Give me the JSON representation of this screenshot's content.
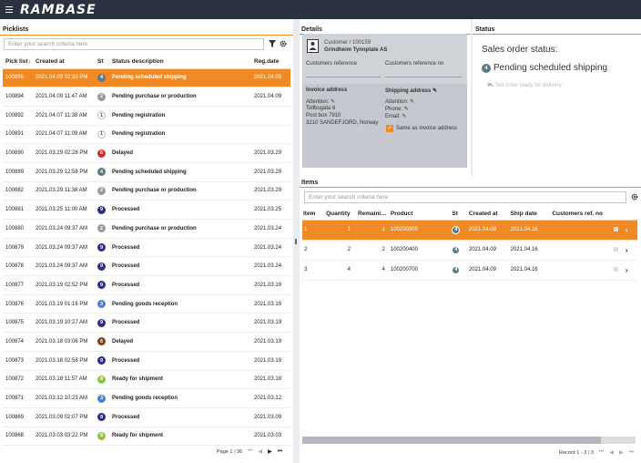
{
  "app": {
    "logo": "RAMBASE"
  },
  "picklists": {
    "title": "Picklists",
    "search_placeholder": "Enter your search criteria here",
    "columns": {
      "id": "Pick list",
      "sort": "↓",
      "created": "Created at",
      "st": "St",
      "desc": "Status description",
      "reg": "Reg.date"
    },
    "rows": [
      {
        "id": "100895",
        "created": "2021.04.09 02:20 PM",
        "st": "4",
        "st_color": "#5e7886",
        "desc": "Pending scheduled shipping",
        "reg": "2021.04.09",
        "selected": true
      },
      {
        "id": "100894",
        "created": "2021.04.09 11:47 AM",
        "st": "2",
        "st_color": "#9a9a9a",
        "desc": "Pending purchase or production",
        "reg": "2021.04.09"
      },
      {
        "id": "100892",
        "created": "2021.04.07 11:38 AM",
        "st": "1",
        "st_color": "outline",
        "desc": "Pending registration",
        "reg": ""
      },
      {
        "id": "100891",
        "created": "2021.04.07 11:09 AM",
        "st": "1",
        "st_color": "outline",
        "desc": "Pending registration",
        "reg": ""
      },
      {
        "id": "100890",
        "created": "2021.03.29 02:28 PM",
        "st": "6",
        "st_color": "#d92b2b",
        "desc": "Delayed",
        "reg": "2021.03.29"
      },
      {
        "id": "100889",
        "created": "2021.03.29 12:58 PM",
        "st": "4",
        "st_color": "#5e7886",
        "desc": "Pending scheduled shipping",
        "reg": "2021.03.29"
      },
      {
        "id": "100882",
        "created": "2021.03.29 11:38 AM",
        "st": "2",
        "st_color": "#9a9a9a",
        "desc": "Pending purchase or production",
        "reg": "2021.03.29"
      },
      {
        "id": "100881",
        "created": "2021.03.25 11:00 AM",
        "st": "9",
        "st_color": "#2a2f8f",
        "desc": "Processed",
        "reg": "2021.03.25"
      },
      {
        "id": "100880",
        "created": "2021.03.24 09:37 AM",
        "st": "2",
        "st_color": "#9a9a9a",
        "desc": "Pending purchase or production",
        "reg": "2021.03.24"
      },
      {
        "id": "100879",
        "created": "2021.03.24 09:37 AM",
        "st": "9",
        "st_color": "#2a2f8f",
        "desc": "Processed",
        "reg": "2021.03.24"
      },
      {
        "id": "100878",
        "created": "2021.03.24 09:37 AM",
        "st": "9",
        "st_color": "#2a2f8f",
        "desc": "Processed",
        "reg": "2021.03.24"
      },
      {
        "id": "100877",
        "created": "2021.03.19 02:52 PM",
        "st": "9",
        "st_color": "#2a2f8f",
        "desc": "Processed",
        "reg": "2021.03.19"
      },
      {
        "id": "100876",
        "created": "2021.03.19 01:16 PM",
        "st": "3",
        "st_color": "#4a7fd6",
        "desc": "Pending goods reception",
        "reg": "2021.03.19"
      },
      {
        "id": "100875",
        "created": "2021.03.19 10:27 AM",
        "st": "9",
        "st_color": "#2a2f8f",
        "desc": "Processed",
        "reg": "2021.03.19"
      },
      {
        "id": "100874",
        "created": "2021.03.18 03:06 PM",
        "st": "6",
        "st_color": "#8a3b1a",
        "desc": "Delayed",
        "reg": "2021.03.19"
      },
      {
        "id": "100873",
        "created": "2021.03.18 02:58 PM",
        "st": "9",
        "st_color": "#2a2f8f",
        "desc": "Processed",
        "reg": "2021.03.19"
      },
      {
        "id": "100872",
        "created": "2021.03.18 11:57 AM",
        "st": "8",
        "st_color": "#8cc63f",
        "desc": "Ready for shipment",
        "reg": "2021.03.18"
      },
      {
        "id": "100871",
        "created": "2021.03.12 10:23 AM",
        "st": "3",
        "st_color": "#4a7fd6",
        "desc": "Pending goods reception",
        "reg": "2021.03.12"
      },
      {
        "id": "100869",
        "created": "2021.03.09 02:07 PM",
        "st": "9",
        "st_color": "#2a2f8f",
        "desc": "Processed",
        "reg": "2021.03.09"
      },
      {
        "id": "100868",
        "created": "2021.03.03 03:22 PM",
        "st": "8",
        "st_color": "#8cc63f",
        "desc": "Ready for shipment",
        "reg": "2021.03.03"
      }
    ],
    "pager": {
      "label": "Page 1 / 36",
      "first": "⏮",
      "prev": "◀",
      "next": "▶",
      "last": "⏭"
    }
  },
  "details": {
    "title": "Details",
    "customer_label": "Customer / 100159",
    "customer_name": "Grindheim Tynnplate AS",
    "customers_reference_label": "Customers reference",
    "customers_reference_no_label": "Customers reference no",
    "invoice_address_label": "Invoice address",
    "shipping_address_label": "Shipping address",
    "attention_label": "Attention:",
    "invoice_lines": [
      "Tollbugata 6",
      "Post box 7910",
      "3210 SANDEFJORD, Norway"
    ],
    "shipping_attention": "Attention:",
    "shipping_phone": "Phone:",
    "shipping_email": "Email:",
    "same_as_invoice": "Same as invoice address"
  },
  "status": {
    "title": "Status",
    "heading": "Sales order status:",
    "badge": "4",
    "badge_color": "#5e7886",
    "value": "Pending scheduled shipping",
    "action": "Set order ready for delivery"
  },
  "items": {
    "title": "Items",
    "search_placeholder": "Enter your search criteria here",
    "columns": {
      "item": "Item",
      "qty": "Quantity",
      "rem": "Remaini…",
      "product": "Product",
      "st": "St",
      "created": "Created at",
      "ship": "Ship date",
      "ref": "Customers ref. no"
    },
    "rows": [
      {
        "item": "1",
        "qty": "1",
        "rem": "1",
        "product": "100200300",
        "st": "4",
        "created": "2021.04.09",
        "ship": "2021.04.16",
        "selected": true
      },
      {
        "item": "2",
        "qty": "2",
        "rem": "2",
        "product": "100200400",
        "st": "4",
        "created": "2021.04.09",
        "ship": "2021.04.16"
      },
      {
        "item": "3",
        "qty": "4",
        "rem": "4",
        "product": "100200700",
        "st": "4",
        "created": "2021.04.09",
        "ship": "2021.04.16"
      }
    ],
    "pager": {
      "label": "Record 1 - 3 / 3",
      "first": "⏮",
      "prev": "◀",
      "next": "▶",
      "last": "⏭"
    }
  },
  "colors": {
    "accent": "#f08a24",
    "topbar": "#2a3240"
  }
}
